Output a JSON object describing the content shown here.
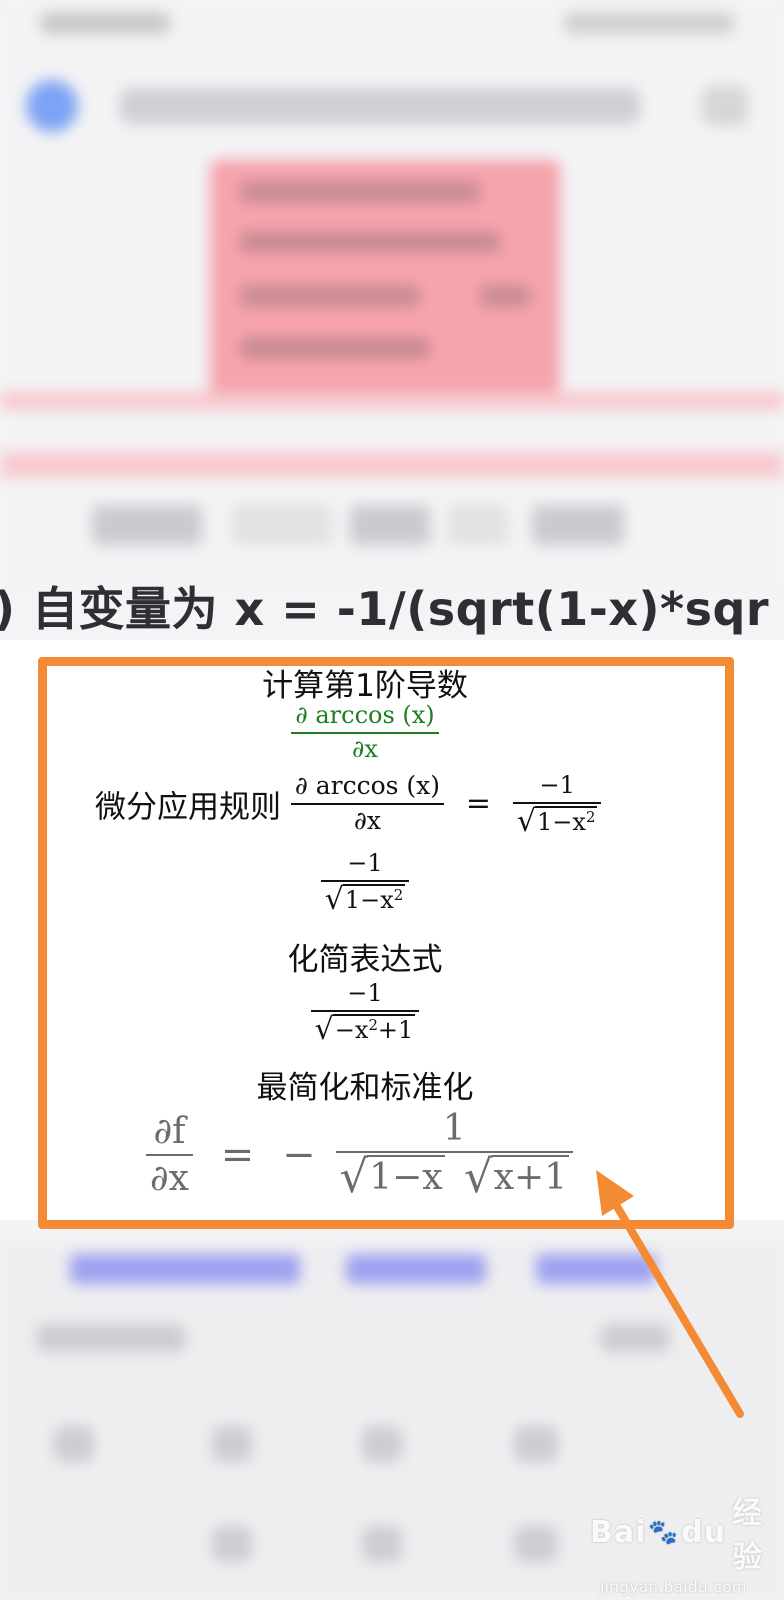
{
  "equation_line": {
    "text": ") 自变量为 x = -1/(sqrt(1-x)*sqr"
  },
  "result": {
    "step1_title": "计算第1阶导数",
    "step1_expr": {
      "numerator": "∂ arccos (x)",
      "denominator": "∂x"
    },
    "step2_label": "微分应用规则",
    "step2_expr": {
      "lhs_numerator": "∂ arccos (x)",
      "lhs_denominator": "∂x",
      "equals": "=",
      "rhs_numerator": "−1",
      "rhs_radicand": "1−x",
      "rhs_exponent": "2"
    },
    "step2_result": {
      "numerator": "−1",
      "radicand": "1−x",
      "exponent": "2"
    },
    "step3_title": "化简表达式",
    "step3_result": {
      "numerator": "−1",
      "radicand_prefix": "−x",
      "exponent": "2",
      "radicand_suffix": "+1"
    },
    "step4_title": "最简化和标准化",
    "final": {
      "lhs_numerator": "∂f",
      "lhs_denominator": "∂x",
      "equals": "=",
      "sign": "−",
      "rhs_numerator": "1",
      "radicand_1": "1−x",
      "radicand_2": "x+1"
    }
  },
  "annotation": {
    "highlight_color": "#f58a35"
  },
  "watermark": {
    "brand_left": "Bai",
    "paw_icon": "paw-icon",
    "brand_right": "du",
    "brand_cn": "经验",
    "domain": "jingyan.baidu.com"
  }
}
